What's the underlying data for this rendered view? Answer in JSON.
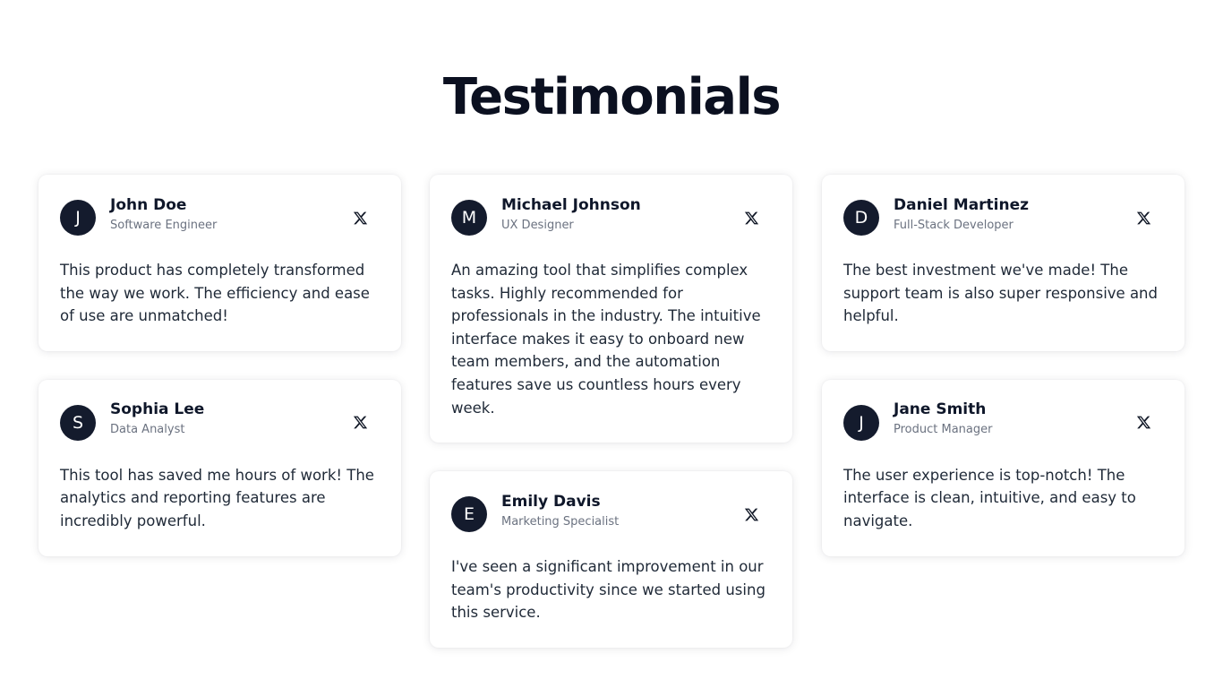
{
  "page": {
    "title": "Testimonials"
  },
  "colors": {
    "avatar_bg": "#141b2d",
    "title": "#0b1020",
    "role_text": "#6b7280"
  },
  "testimonials": [
    {
      "initial": "J",
      "name": "John Doe",
      "role": "Software Engineer",
      "quote": "This product has completely transformed the way we work. The efficiency and ease of use are unmatched!",
      "icon": "x-twitter-icon"
    },
    {
      "initial": "S",
      "name": "Sophia Lee",
      "role": "Data Analyst",
      "quote": "This tool has saved me hours of work! The analytics and reporting features are incredibly powerful.",
      "icon": "x-twitter-icon"
    },
    {
      "initial": "M",
      "name": "Michael Johnson",
      "role": "UX Designer",
      "quote": "An amazing tool that simplifies complex tasks. Highly recommended for professionals in the industry. The intuitive interface makes it easy to onboard new team members, and the automation features save us countless hours every week.",
      "icon": "x-twitter-icon"
    },
    {
      "initial": "E",
      "name": "Emily Davis",
      "role": "Marketing Specialist",
      "quote": "I've seen a significant improvement in our team's productivity since we started using this service.",
      "icon": "x-twitter-icon"
    },
    {
      "initial": "D",
      "name": "Daniel Martinez",
      "role": "Full-Stack Developer",
      "quote": "The best investment we've made! The support team is also super responsive and helpful.",
      "icon": "x-twitter-icon"
    },
    {
      "initial": "J",
      "name": "Jane Smith",
      "role": "Product Manager",
      "quote": "The user experience is top-notch! The interface is clean, intuitive, and easy to navigate.",
      "icon": "x-twitter-icon"
    }
  ]
}
